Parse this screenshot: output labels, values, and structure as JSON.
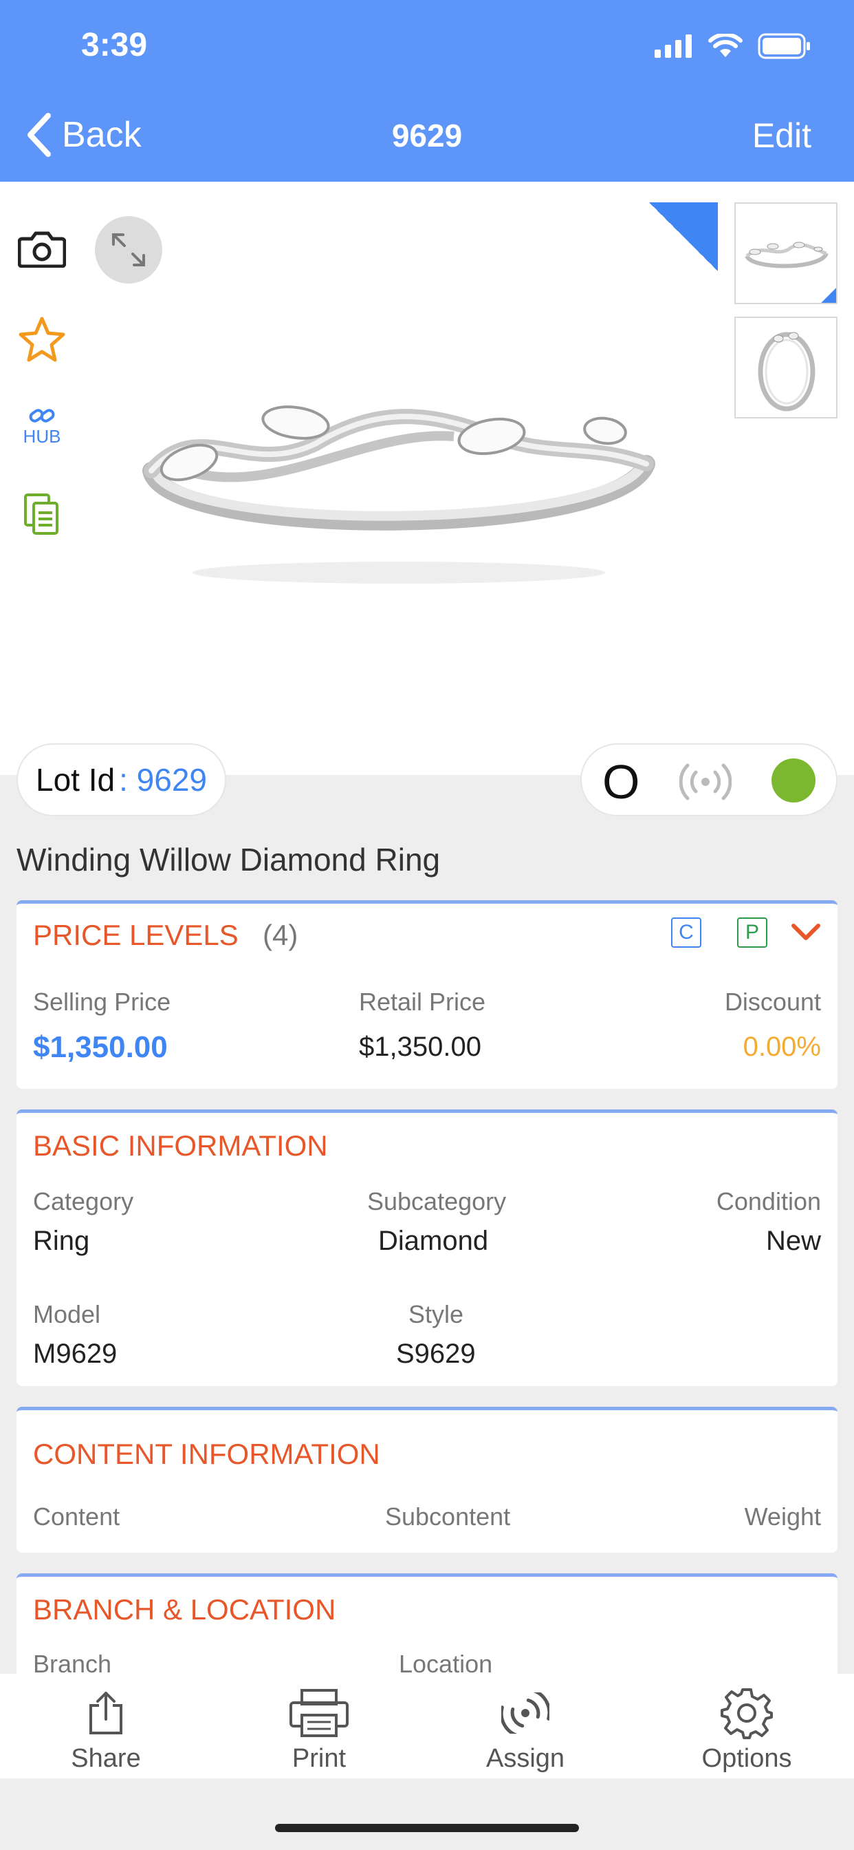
{
  "status_bar": {
    "time": "3:39"
  },
  "nav": {
    "back_label": "Back",
    "title": "9629",
    "edit_label": "Edit"
  },
  "side_tools": {
    "hub_label": "HUB"
  },
  "lot": {
    "label": "Lot Id",
    "value": ": 9629"
  },
  "status": {
    "letter": "O"
  },
  "product": {
    "name": "Winding Willow Diamond Ring"
  },
  "price_levels": {
    "title": "PRICE LEVELS",
    "count": "(4)",
    "badge_c": "C",
    "badge_p": "P",
    "selling_label": "Selling Price",
    "selling_value": "$1,350.00",
    "retail_label": "Retail Price",
    "retail_value": "$1,350.00",
    "discount_label": "Discount",
    "discount_value": "0.00%"
  },
  "basic_info": {
    "title": "BASIC INFORMATION",
    "category_label": "Category",
    "category_value": "Ring",
    "subcategory_label": "Subcategory",
    "subcategory_value": "Diamond",
    "condition_label": "Condition",
    "condition_value": "New",
    "model_label": "Model",
    "model_value": "M9629",
    "style_label": "Style",
    "style_value": "S9629"
  },
  "content_info": {
    "title": "CONTENT INFORMATION",
    "content_label": "Content",
    "subcontent_label": "Subcontent",
    "weight_label": "Weight"
  },
  "branch_location": {
    "title": "BRANCH & LOCATION",
    "branch_label": "Branch",
    "location_label": "Location"
  },
  "tabbar": {
    "share": "Share",
    "print": "Print",
    "assign": "Assign",
    "options": "Options"
  },
  "colors": {
    "header_blue": "#5d95f8",
    "accent_orange": "#e8572a",
    "link_blue": "#3f86f4",
    "status_green": "#7cb82f",
    "discount_amber": "#f4ab34"
  }
}
